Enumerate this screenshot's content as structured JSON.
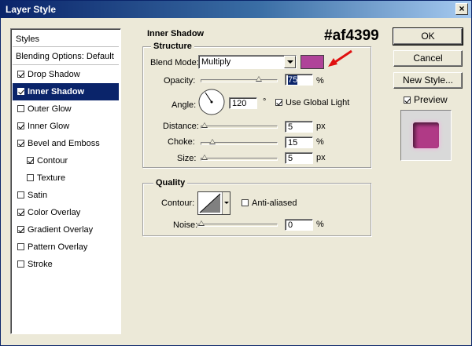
{
  "window": {
    "title": "Layer Style",
    "close_symbol": "×"
  },
  "styles_panel": {
    "header": "Styles",
    "blending": "Blending Options: Default",
    "items": [
      {
        "label": "Drop Shadow",
        "checked": true,
        "active": false,
        "sub": false
      },
      {
        "label": "Inner Shadow",
        "checked": true,
        "active": true,
        "sub": false
      },
      {
        "label": "Outer Glow",
        "checked": false,
        "active": false,
        "sub": false
      },
      {
        "label": "Inner Glow",
        "checked": true,
        "active": false,
        "sub": false
      },
      {
        "label": "Bevel and Emboss",
        "checked": true,
        "active": false,
        "sub": false
      },
      {
        "label": "Contour",
        "checked": true,
        "active": false,
        "sub": true
      },
      {
        "label": "Texture",
        "checked": false,
        "active": false,
        "sub": true
      },
      {
        "label": "Satin",
        "checked": false,
        "active": false,
        "sub": false
      },
      {
        "label": "Color Overlay",
        "checked": true,
        "active": false,
        "sub": false
      },
      {
        "label": "Gradient Overlay",
        "checked": true,
        "active": false,
        "sub": false
      },
      {
        "label": "Pattern Overlay",
        "checked": false,
        "active": false,
        "sub": false
      },
      {
        "label": "Stroke",
        "checked": false,
        "active": false,
        "sub": false
      }
    ]
  },
  "inner_shadow": {
    "section_title": "Inner Shadow",
    "structure": {
      "title": "Structure",
      "blend_mode_label": "Blend Mode:",
      "blend_mode_value": "Multiply",
      "shadow_color": "#af4399",
      "opacity_label": "Opacity:",
      "opacity_value": "75",
      "opacity_unit": "%",
      "angle_label": "Angle:",
      "angle_value": "120",
      "angle_unit": "°",
      "global_light_label": "Use Global Light",
      "global_light_checked": true,
      "distance_label": "Distance:",
      "distance_value": "5",
      "distance_unit": "px",
      "choke_label": "Choke:",
      "choke_value": "15",
      "choke_unit": "%",
      "size_label": "Size:",
      "size_value": "5",
      "size_unit": "px"
    },
    "quality": {
      "title": "Quality",
      "contour_label": "Contour:",
      "anti_aliased_label": "Anti-aliased",
      "anti_aliased_checked": false,
      "noise_label": "Noise:",
      "noise_value": "0",
      "noise_unit": "%"
    }
  },
  "buttons": {
    "ok": "OK",
    "cancel": "Cancel",
    "new_style": "New Style...",
    "preview_label": "Preview",
    "preview_checked": true
  },
  "annotation": {
    "text": "#af4399",
    "arrow_color": "#e01010"
  },
  "colors": {
    "accent": "#0a246a",
    "face": "#ece9d8",
    "preview_fill": "#b03a86"
  }
}
